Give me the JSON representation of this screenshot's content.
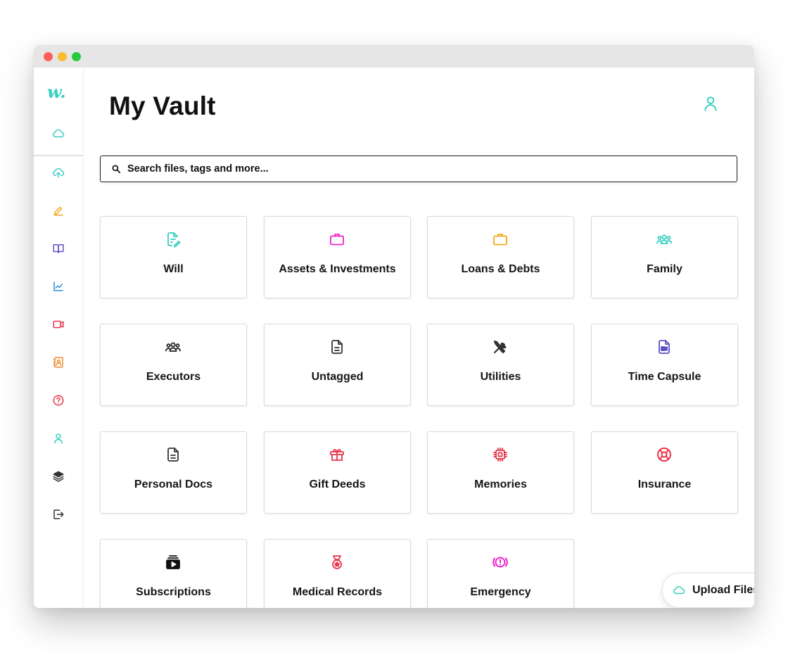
{
  "app": {
    "logo": "w.",
    "title": "My Vault"
  },
  "colors": {
    "accent": "#35cfc2",
    "magenta": "#ee22cc",
    "amber": "#f0a81a",
    "indigo": "#5b4fc4",
    "red": "#e8354a",
    "dark": "#333333"
  },
  "sidebar": {
    "items": [
      {
        "icon": "cloud-icon",
        "color": "#35cfc2"
      },
      {
        "icon": "cloud-upload-icon",
        "color": "#35cfc2"
      },
      {
        "icon": "pencil-icon",
        "color": "#f0a81a"
      },
      {
        "icon": "book-icon",
        "color": "#5b4fc4"
      },
      {
        "icon": "chart-line-icon",
        "color": "#2f8ed6"
      },
      {
        "icon": "video-icon",
        "color": "#e8354a"
      },
      {
        "icon": "contact-card-icon",
        "color": "#f08a2c"
      },
      {
        "icon": "help-circle-icon",
        "color": "#e8354a"
      },
      {
        "icon": "user-icon",
        "color": "#35cfc2"
      },
      {
        "icon": "layers-icon",
        "color": "#333333"
      },
      {
        "icon": "logout-icon",
        "color": "#333333"
      }
    ]
  },
  "search": {
    "placeholder": "Search files, tags and more..."
  },
  "categories": [
    {
      "label": "Will",
      "icon": "document-edit-icon",
      "color": "#35cfc2"
    },
    {
      "label": "Assets & Investments",
      "icon": "briefcase-icon",
      "color": "#ee22cc"
    },
    {
      "label": "Loans & Debts",
      "icon": "briefcase-icon",
      "color": "#f0a81a"
    },
    {
      "label": "Family",
      "icon": "group-icon",
      "color": "#35cfc2"
    },
    {
      "label": "Executors",
      "icon": "group-icon",
      "color": "#222222"
    },
    {
      "label": "Untagged",
      "icon": "document-icon",
      "color": "#333333"
    },
    {
      "label": "Utilities",
      "icon": "tools-icon",
      "color": "#333333"
    },
    {
      "label": "Time Capsule",
      "icon": "video-file-icon",
      "color": "#5b4fc4"
    },
    {
      "label": "Personal Docs",
      "icon": "document-icon",
      "color": "#333333"
    },
    {
      "label": "Gift Deeds",
      "icon": "gift-icon",
      "color": "#e8354a"
    },
    {
      "label": "Memories",
      "icon": "chip-icon",
      "color": "#e8354a"
    },
    {
      "label": "Insurance",
      "icon": "lifebuoy-icon",
      "color": "#e8354a"
    },
    {
      "label": "Subscriptions",
      "icon": "subscriptions-icon",
      "color": "#111111"
    },
    {
      "label": "Medical Records",
      "icon": "medal-icon",
      "color": "#e8354a"
    },
    {
      "label": "Emergency",
      "icon": "alert-icon",
      "color": "#ee22cc"
    }
  ],
  "upload": {
    "label": "Upload Files.."
  }
}
